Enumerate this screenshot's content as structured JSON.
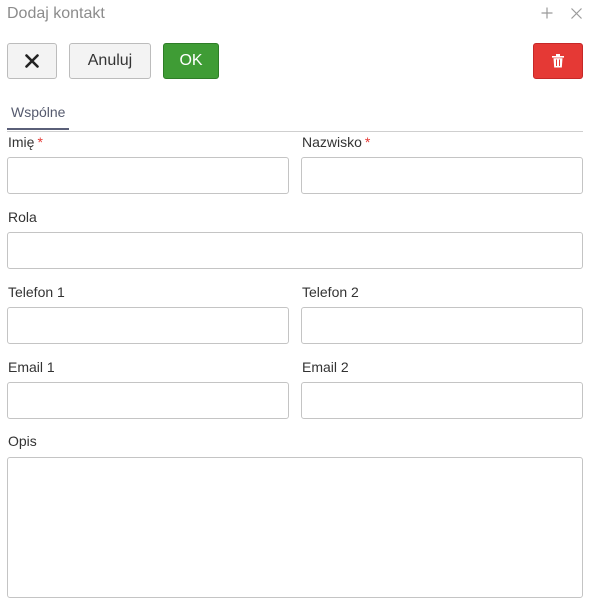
{
  "dialog": {
    "title": "Dodaj kontakt"
  },
  "toolbar": {
    "cancel_label": "Anuluj",
    "ok_label": "OK"
  },
  "tabs": [
    {
      "label": "Wspólne",
      "active": true
    }
  ],
  "form": {
    "first_name": {
      "label": "Imię",
      "required_mark": "*",
      "value": ""
    },
    "last_name": {
      "label": "Nazwisko",
      "required_mark": "*",
      "value": ""
    },
    "role": {
      "label": "Rola",
      "value": ""
    },
    "phone1": {
      "label": "Telefon 1",
      "value": ""
    },
    "phone2": {
      "label": "Telefon 2",
      "value": ""
    },
    "email1": {
      "label": "Email 1",
      "value": ""
    },
    "email2": {
      "label": "Email 2",
      "value": ""
    },
    "description": {
      "label": "Opis",
      "value": ""
    }
  },
  "colors": {
    "ok": "#3f9c35",
    "delete": "#e53935",
    "required": "#e53935",
    "tab_active": "#5a5f78"
  },
  "icons": {
    "titlebar": [
      "plus-icon",
      "close-icon"
    ],
    "toolbar": [
      "close-icon",
      "trash-icon"
    ]
  }
}
